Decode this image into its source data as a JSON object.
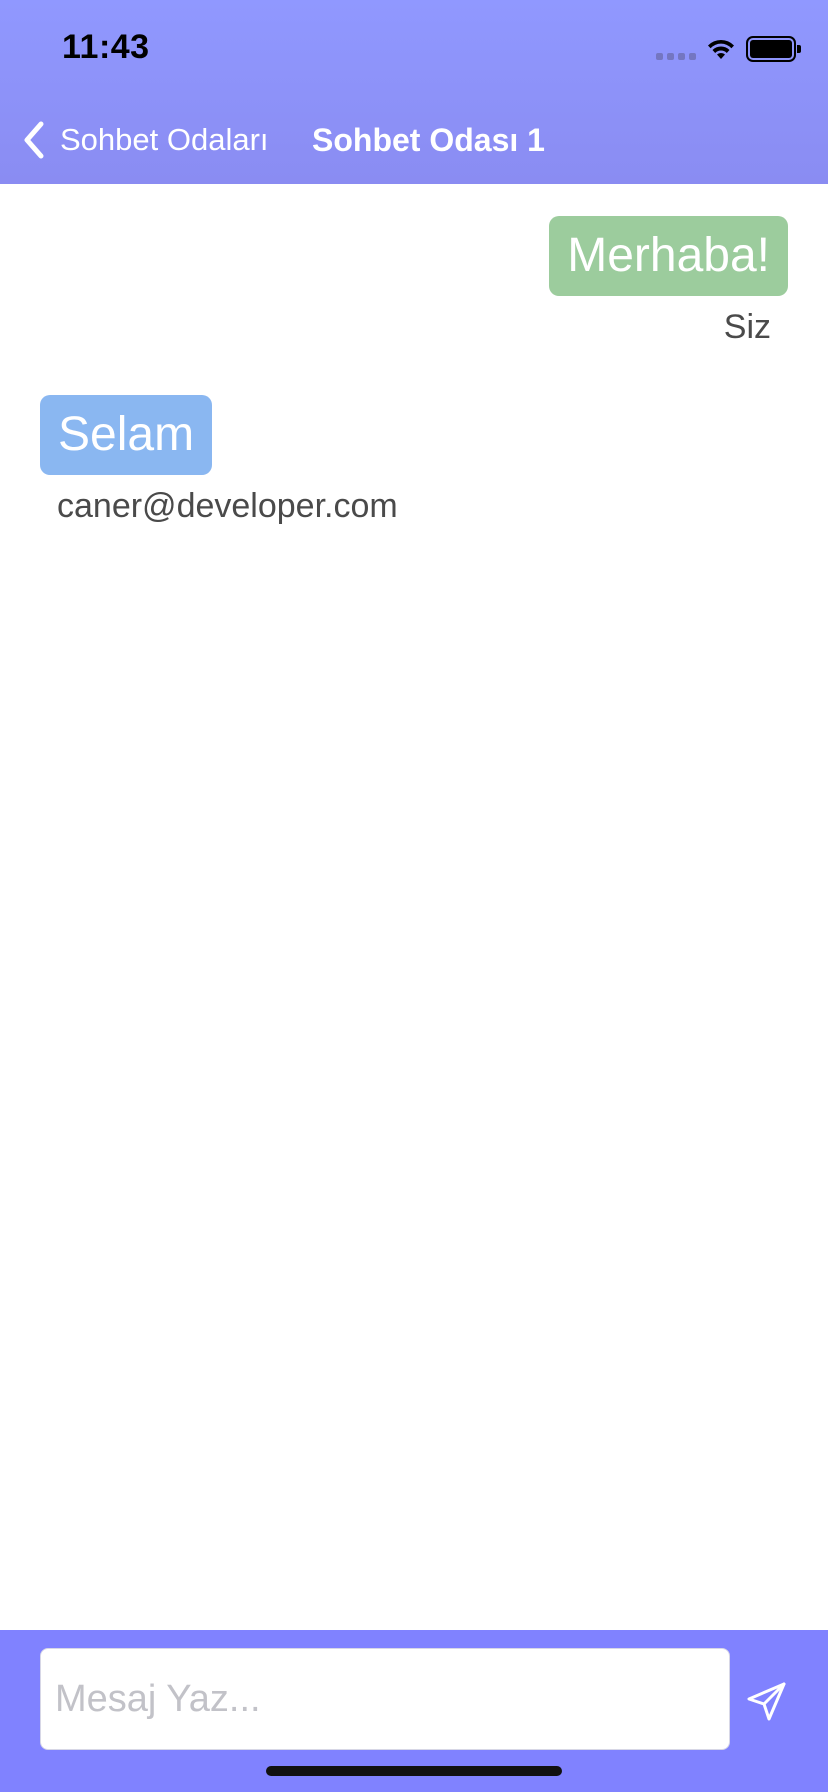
{
  "status_bar": {
    "time": "11:43"
  },
  "nav": {
    "back_label": "Sohbet Odaları",
    "title": "Sohbet Odası 1"
  },
  "messages": [
    {
      "text": "Merhaba!",
      "sender": "Siz",
      "mine": true,
      "color": "#9ccc9d"
    },
    {
      "text": "Selam",
      "sender": "caner@developer.com",
      "mine": false,
      "color": "#8ab7f1"
    }
  ],
  "composer": {
    "placeholder": "Mesaj Yaz...",
    "bar_color": "#8082ff"
  },
  "icons": {
    "back": "chevron-left-icon",
    "send": "send-icon",
    "wifi": "wifi-icon",
    "battery": "battery-icon",
    "signal": "signal-icon"
  }
}
